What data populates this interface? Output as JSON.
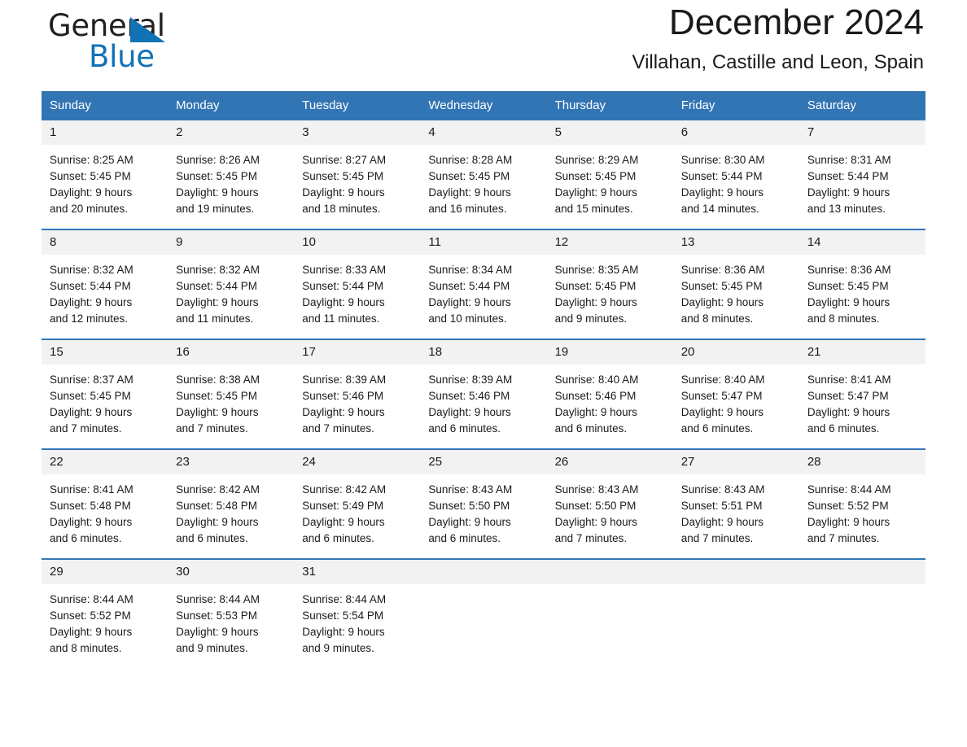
{
  "brand": {
    "name_part1": "General",
    "name_part2": "Blue",
    "logo_icon": "triangle-icon",
    "accent_color": "#1272b6"
  },
  "header": {
    "title": "December 2024",
    "subtitle": "Villahan, Castille and Leon, Spain"
  },
  "theme": {
    "header_blue": "#3275b5",
    "daynum_band": "#f2f2f2",
    "text": "#1a1a1a"
  },
  "weekday_headers": [
    "Sunday",
    "Monday",
    "Tuesday",
    "Wednesday",
    "Thursday",
    "Friday",
    "Saturday"
  ],
  "weeks": [
    [
      {
        "day": "1",
        "sunrise": "Sunrise: 8:25 AM",
        "sunset": "Sunset: 5:45 PM",
        "daylight_line1": "Daylight: 9 hours",
        "daylight_line2": "and 20 minutes."
      },
      {
        "day": "2",
        "sunrise": "Sunrise: 8:26 AM",
        "sunset": "Sunset: 5:45 PM",
        "daylight_line1": "Daylight: 9 hours",
        "daylight_line2": "and 19 minutes."
      },
      {
        "day": "3",
        "sunrise": "Sunrise: 8:27 AM",
        "sunset": "Sunset: 5:45 PM",
        "daylight_line1": "Daylight: 9 hours",
        "daylight_line2": "and 18 minutes."
      },
      {
        "day": "4",
        "sunrise": "Sunrise: 8:28 AM",
        "sunset": "Sunset: 5:45 PM",
        "daylight_line1": "Daylight: 9 hours",
        "daylight_line2": "and 16 minutes."
      },
      {
        "day": "5",
        "sunrise": "Sunrise: 8:29 AM",
        "sunset": "Sunset: 5:45 PM",
        "daylight_line1": "Daylight: 9 hours",
        "daylight_line2": "and 15 minutes."
      },
      {
        "day": "6",
        "sunrise": "Sunrise: 8:30 AM",
        "sunset": "Sunset: 5:44 PM",
        "daylight_line1": "Daylight: 9 hours",
        "daylight_line2": "and 14 minutes."
      },
      {
        "day": "7",
        "sunrise": "Sunrise: 8:31 AM",
        "sunset": "Sunset: 5:44 PM",
        "daylight_line1": "Daylight: 9 hours",
        "daylight_line2": "and 13 minutes."
      }
    ],
    [
      {
        "day": "8",
        "sunrise": "Sunrise: 8:32 AM",
        "sunset": "Sunset: 5:44 PM",
        "daylight_line1": "Daylight: 9 hours",
        "daylight_line2": "and 12 minutes."
      },
      {
        "day": "9",
        "sunrise": "Sunrise: 8:32 AM",
        "sunset": "Sunset: 5:44 PM",
        "daylight_line1": "Daylight: 9 hours",
        "daylight_line2": "and 11 minutes."
      },
      {
        "day": "10",
        "sunrise": "Sunrise: 8:33 AM",
        "sunset": "Sunset: 5:44 PM",
        "daylight_line1": "Daylight: 9 hours",
        "daylight_line2": "and 11 minutes."
      },
      {
        "day": "11",
        "sunrise": "Sunrise: 8:34 AM",
        "sunset": "Sunset: 5:44 PM",
        "daylight_line1": "Daylight: 9 hours",
        "daylight_line2": "and 10 minutes."
      },
      {
        "day": "12",
        "sunrise": "Sunrise: 8:35 AM",
        "sunset": "Sunset: 5:45 PM",
        "daylight_line1": "Daylight: 9 hours",
        "daylight_line2": "and 9 minutes."
      },
      {
        "day": "13",
        "sunrise": "Sunrise: 8:36 AM",
        "sunset": "Sunset: 5:45 PM",
        "daylight_line1": "Daylight: 9 hours",
        "daylight_line2": "and 8 minutes."
      },
      {
        "day": "14",
        "sunrise": "Sunrise: 8:36 AM",
        "sunset": "Sunset: 5:45 PM",
        "daylight_line1": "Daylight: 9 hours",
        "daylight_line2": "and 8 minutes."
      }
    ],
    [
      {
        "day": "15",
        "sunrise": "Sunrise: 8:37 AM",
        "sunset": "Sunset: 5:45 PM",
        "daylight_line1": "Daylight: 9 hours",
        "daylight_line2": "and 7 minutes."
      },
      {
        "day": "16",
        "sunrise": "Sunrise: 8:38 AM",
        "sunset": "Sunset: 5:45 PM",
        "daylight_line1": "Daylight: 9 hours",
        "daylight_line2": "and 7 minutes."
      },
      {
        "day": "17",
        "sunrise": "Sunrise: 8:39 AM",
        "sunset": "Sunset: 5:46 PM",
        "daylight_line1": "Daylight: 9 hours",
        "daylight_line2": "and 7 minutes."
      },
      {
        "day": "18",
        "sunrise": "Sunrise: 8:39 AM",
        "sunset": "Sunset: 5:46 PM",
        "daylight_line1": "Daylight: 9 hours",
        "daylight_line2": "and 6 minutes."
      },
      {
        "day": "19",
        "sunrise": "Sunrise: 8:40 AM",
        "sunset": "Sunset: 5:46 PM",
        "daylight_line1": "Daylight: 9 hours",
        "daylight_line2": "and 6 minutes."
      },
      {
        "day": "20",
        "sunrise": "Sunrise: 8:40 AM",
        "sunset": "Sunset: 5:47 PM",
        "daylight_line1": "Daylight: 9 hours",
        "daylight_line2": "and 6 minutes."
      },
      {
        "day": "21",
        "sunrise": "Sunrise: 8:41 AM",
        "sunset": "Sunset: 5:47 PM",
        "daylight_line1": "Daylight: 9 hours",
        "daylight_line2": "and 6 minutes."
      }
    ],
    [
      {
        "day": "22",
        "sunrise": "Sunrise: 8:41 AM",
        "sunset": "Sunset: 5:48 PM",
        "daylight_line1": "Daylight: 9 hours",
        "daylight_line2": "and 6 minutes."
      },
      {
        "day": "23",
        "sunrise": "Sunrise: 8:42 AM",
        "sunset": "Sunset: 5:48 PM",
        "daylight_line1": "Daylight: 9 hours",
        "daylight_line2": "and 6 minutes."
      },
      {
        "day": "24",
        "sunrise": "Sunrise: 8:42 AM",
        "sunset": "Sunset: 5:49 PM",
        "daylight_line1": "Daylight: 9 hours",
        "daylight_line2": "and 6 minutes."
      },
      {
        "day": "25",
        "sunrise": "Sunrise: 8:43 AM",
        "sunset": "Sunset: 5:50 PM",
        "daylight_line1": "Daylight: 9 hours",
        "daylight_line2": "and 6 minutes."
      },
      {
        "day": "26",
        "sunrise": "Sunrise: 8:43 AM",
        "sunset": "Sunset: 5:50 PM",
        "daylight_line1": "Daylight: 9 hours",
        "daylight_line2": "and 7 minutes."
      },
      {
        "day": "27",
        "sunrise": "Sunrise: 8:43 AM",
        "sunset": "Sunset: 5:51 PM",
        "daylight_line1": "Daylight: 9 hours",
        "daylight_line2": "and 7 minutes."
      },
      {
        "day": "28",
        "sunrise": "Sunrise: 8:44 AM",
        "sunset": "Sunset: 5:52 PM",
        "daylight_line1": "Daylight: 9 hours",
        "daylight_line2": "and 7 minutes."
      }
    ],
    [
      {
        "day": "29",
        "sunrise": "Sunrise: 8:44 AM",
        "sunset": "Sunset: 5:52 PM",
        "daylight_line1": "Daylight: 9 hours",
        "daylight_line2": "and 8 minutes."
      },
      {
        "day": "30",
        "sunrise": "Sunrise: 8:44 AM",
        "sunset": "Sunset: 5:53 PM",
        "daylight_line1": "Daylight: 9 hours",
        "daylight_line2": "and 9 minutes."
      },
      {
        "day": "31",
        "sunrise": "Sunrise: 8:44 AM",
        "sunset": "Sunset: 5:54 PM",
        "daylight_line1": "Daylight: 9 hours",
        "daylight_line2": "and 9 minutes."
      },
      {
        "day": "",
        "sunrise": "",
        "sunset": "",
        "daylight_line1": "",
        "daylight_line2": ""
      },
      {
        "day": "",
        "sunrise": "",
        "sunset": "",
        "daylight_line1": "",
        "daylight_line2": ""
      },
      {
        "day": "",
        "sunrise": "",
        "sunset": "",
        "daylight_line1": "",
        "daylight_line2": ""
      },
      {
        "day": "",
        "sunrise": "",
        "sunset": "",
        "daylight_line1": "",
        "daylight_line2": ""
      }
    ]
  ]
}
